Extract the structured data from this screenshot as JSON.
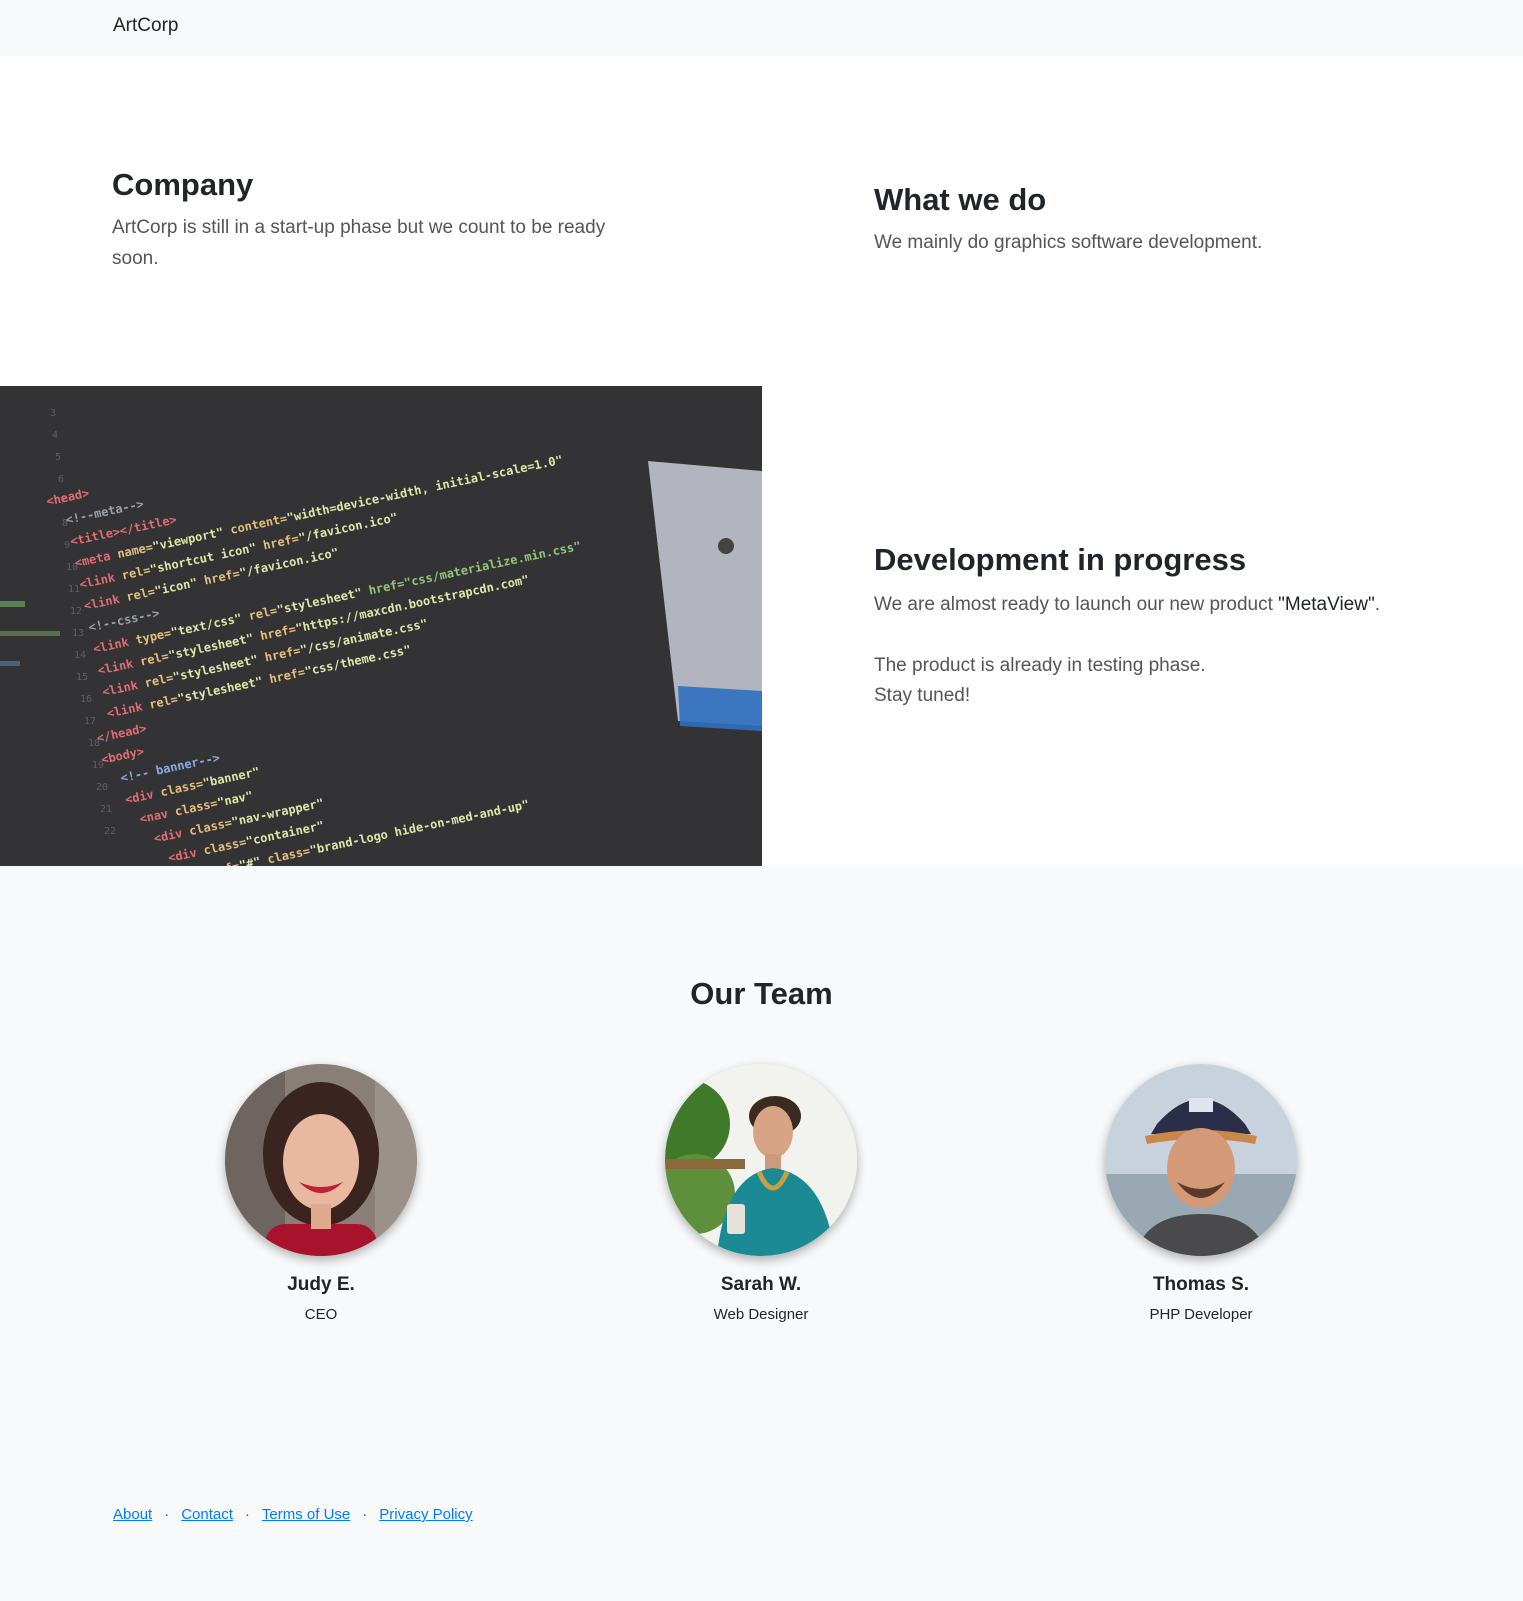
{
  "navbar": {
    "brand": "ArtCorp"
  },
  "intro": {
    "company": {
      "title": "Company",
      "text": "ArtCorp is still in a start-up phase but we count to be ready soon."
    },
    "what_we_do": {
      "title": "What we do",
      "text": "We mainly do graphics software development."
    }
  },
  "showcase": {
    "title": "Development in progress",
    "text_before": "We are almost ready to launch our new product ",
    "product": "\"MetaView\"",
    "text_after": ".",
    "line2": "The product is already in testing phase.",
    "line3": "Stay tuned!",
    "image_icon": "code-screenshot-image"
  },
  "team": {
    "title": "Our Team",
    "members": [
      {
        "name": "Judy E.",
        "role": "CEO"
      },
      {
        "name": "Sarah W.",
        "role": "Web Designer"
      },
      {
        "name": "Thomas S.",
        "role": "PHP Developer"
      }
    ]
  },
  "footer": {
    "links": [
      "About",
      "Contact",
      "Terms of Use",
      "Privacy Policy"
    ],
    "separator": "·",
    "link_color": "#007bff"
  }
}
